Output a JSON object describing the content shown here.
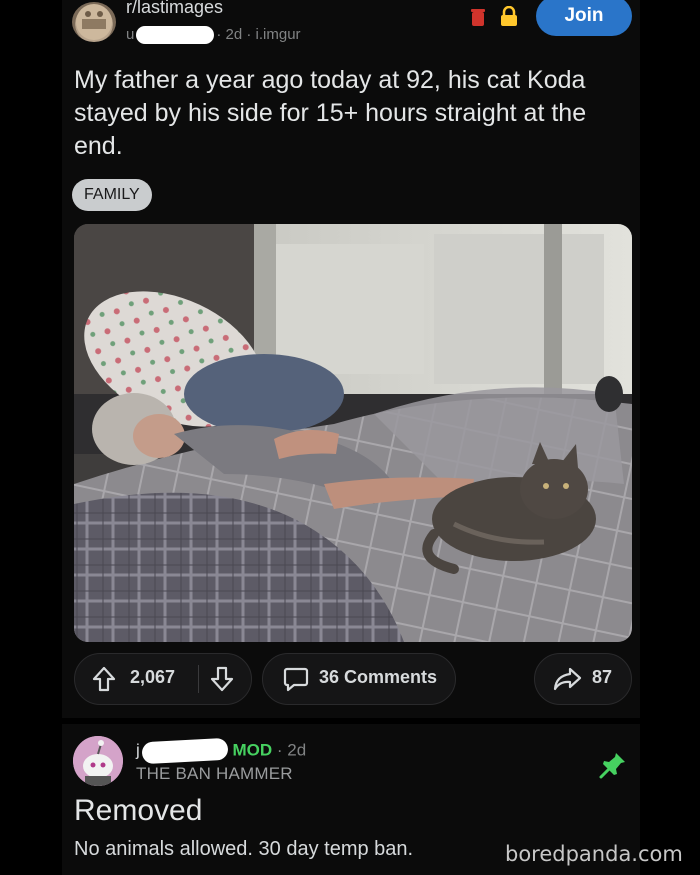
{
  "post": {
    "subreddit": "r/lastimages",
    "user_prefix": "u",
    "meta_suffix": "· 2d · i.imgur",
    "join_label": "Join",
    "title": "My father a year ago today at 92, his cat Koda stayed by his side for 15+ hours straight at the end.",
    "flair": "FAMILY"
  },
  "actions": {
    "score": "2,067",
    "comments": "36 Comments",
    "shares": "87"
  },
  "comment": {
    "user_prefix": "j",
    "mod_badge": "MOD",
    "time": "· 2d",
    "user_flair": "THE BAN HAMMER",
    "heading": "Removed",
    "body": "No animals allowed. 30 day temp ban."
  },
  "watermark": "boredpanda.com",
  "colors": {
    "background": "#0b0b0b",
    "join_button": "#2a75c9",
    "mod_green": "#46d160",
    "flair_bg": "#c9ccce",
    "comment_avatar": "#d4a3c9"
  },
  "icons": [
    "upvote-icon",
    "downvote-icon",
    "comment-icon",
    "share-icon",
    "pin-icon",
    "trash-icon",
    "lock-icon"
  ]
}
